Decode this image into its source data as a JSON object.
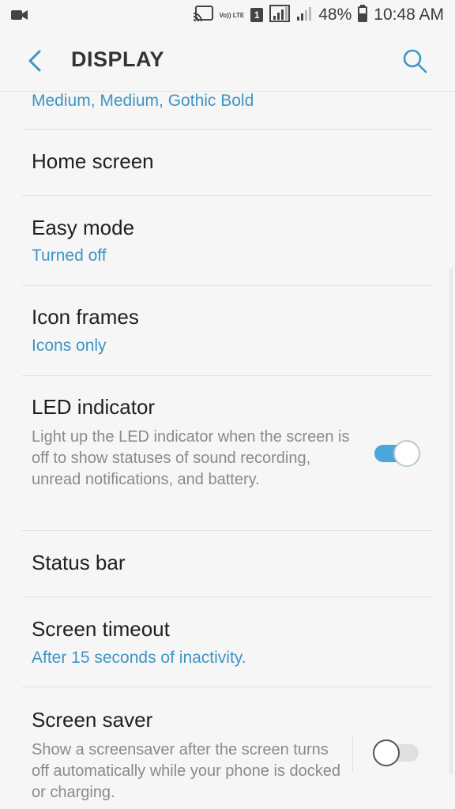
{
  "status_bar": {
    "battery_percent": "48%",
    "time": "10:48 AM",
    "network_label": "Vo)) LTE",
    "sim_slot": "1",
    "icons": [
      "video-camera-icon",
      "cast-icon",
      "volte-icon",
      "sim-icon",
      "signal-icon",
      "signal-weak-icon",
      "battery-icon"
    ]
  },
  "header": {
    "title": "DISPLAY",
    "icons": [
      "back-arrow-icon",
      "search-icon"
    ]
  },
  "settings": {
    "partial_subtitle": "Medium, Medium, Gothic Bold",
    "items": [
      {
        "title": "Home screen"
      },
      {
        "title": "Easy mode",
        "subtitle": "Turned off"
      },
      {
        "title": "Icon frames",
        "subtitle": "Icons only"
      },
      {
        "title": "LED indicator",
        "description": "Light up the LED indicator when the screen is off to show statuses of sound recording, unread notifications, and battery.",
        "toggle": true
      },
      {
        "title": "Status bar"
      },
      {
        "title": "Screen timeout",
        "subtitle": "After 15 seconds of inactivity."
      },
      {
        "title": "Screen saver",
        "description": "Show a screensaver after the screen turns off automatically while your phone is docked or charging.",
        "toggle": false
      }
    ]
  },
  "colors": {
    "accent": "#3f94c4",
    "toggle_on": "#4ba6dc",
    "background": "#f6f6f6"
  }
}
